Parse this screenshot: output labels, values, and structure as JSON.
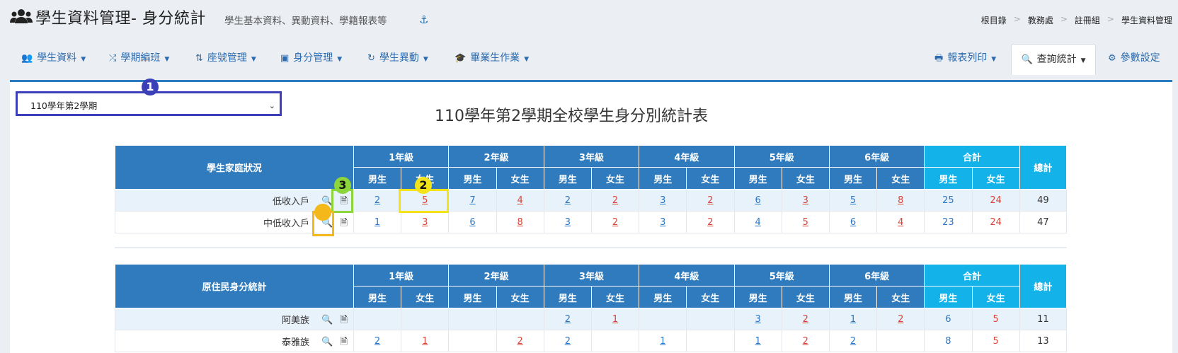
{
  "header": {
    "title": "學生資料管理- 身分統計",
    "subtitle": "學生基本資料、異動資料、學籍報表等",
    "breadcrumb": [
      "根目錄",
      "教務處",
      "註冊組",
      "學生資料管理"
    ]
  },
  "nav": {
    "left": [
      {
        "label": "學生資料",
        "icon": "users-icon"
      },
      {
        "label": "學期編班",
        "icon": "shuffle-icon"
      },
      {
        "label": "座號管理",
        "icon": "sort-icon"
      },
      {
        "label": "身分管理",
        "icon": "id-card-icon"
      },
      {
        "label": "學生異動",
        "icon": "refresh-icon"
      },
      {
        "label": "畢業生作業",
        "icon": "graduation-cap-icon"
      }
    ],
    "right": [
      {
        "label": "報表列印",
        "icon": "print-icon"
      },
      {
        "label": "查詢統計",
        "icon": "search-icon",
        "active": true
      },
      {
        "label": "參數設定",
        "icon": "gear-icon"
      }
    ]
  },
  "semester_select": {
    "value": "110學年第2學期"
  },
  "page_title": "110學年第2學期全校學生身分別統計表",
  "markers": [
    "1",
    "2",
    "3"
  ],
  "headers": {
    "grades": [
      "1年級",
      "2年級",
      "3年級",
      "4年級",
      "5年級",
      "6年級"
    ],
    "total": "合計",
    "grand_total": "總計",
    "male": "男生",
    "female": "女生"
  },
  "table1": {
    "title": "學生家庭狀況",
    "rows": [
      {
        "label": "低收入戶",
        "cells": [
          "2",
          "5",
          "7",
          "4",
          "2",
          "2",
          "3",
          "2",
          "6",
          "3",
          "5",
          "8"
        ],
        "total_m": "25",
        "total_f": "24",
        "grand": "49"
      },
      {
        "label": "中低收入戶",
        "cells": [
          "1",
          "3",
          "6",
          "8",
          "3",
          "2",
          "3",
          "2",
          "4",
          "5",
          "6",
          "4"
        ],
        "total_m": "23",
        "total_f": "24",
        "grand": "47"
      }
    ]
  },
  "table2": {
    "title": "原住民身分統計",
    "rows": [
      {
        "label": "阿美族",
        "cells": [
          "",
          "",
          "",
          "",
          "2",
          "1",
          "",
          "",
          "3",
          "2",
          "1",
          "2"
        ],
        "total_m": "6",
        "total_f": "5",
        "grand": "11"
      },
      {
        "label": "泰雅族",
        "cells": [
          "2",
          "1",
          "",
          "2",
          "2",
          "",
          "1",
          "",
          "1",
          "2",
          "2",
          ""
        ],
        "total_m": "8",
        "total_f": "5",
        "grand": "13"
      }
    ]
  }
}
